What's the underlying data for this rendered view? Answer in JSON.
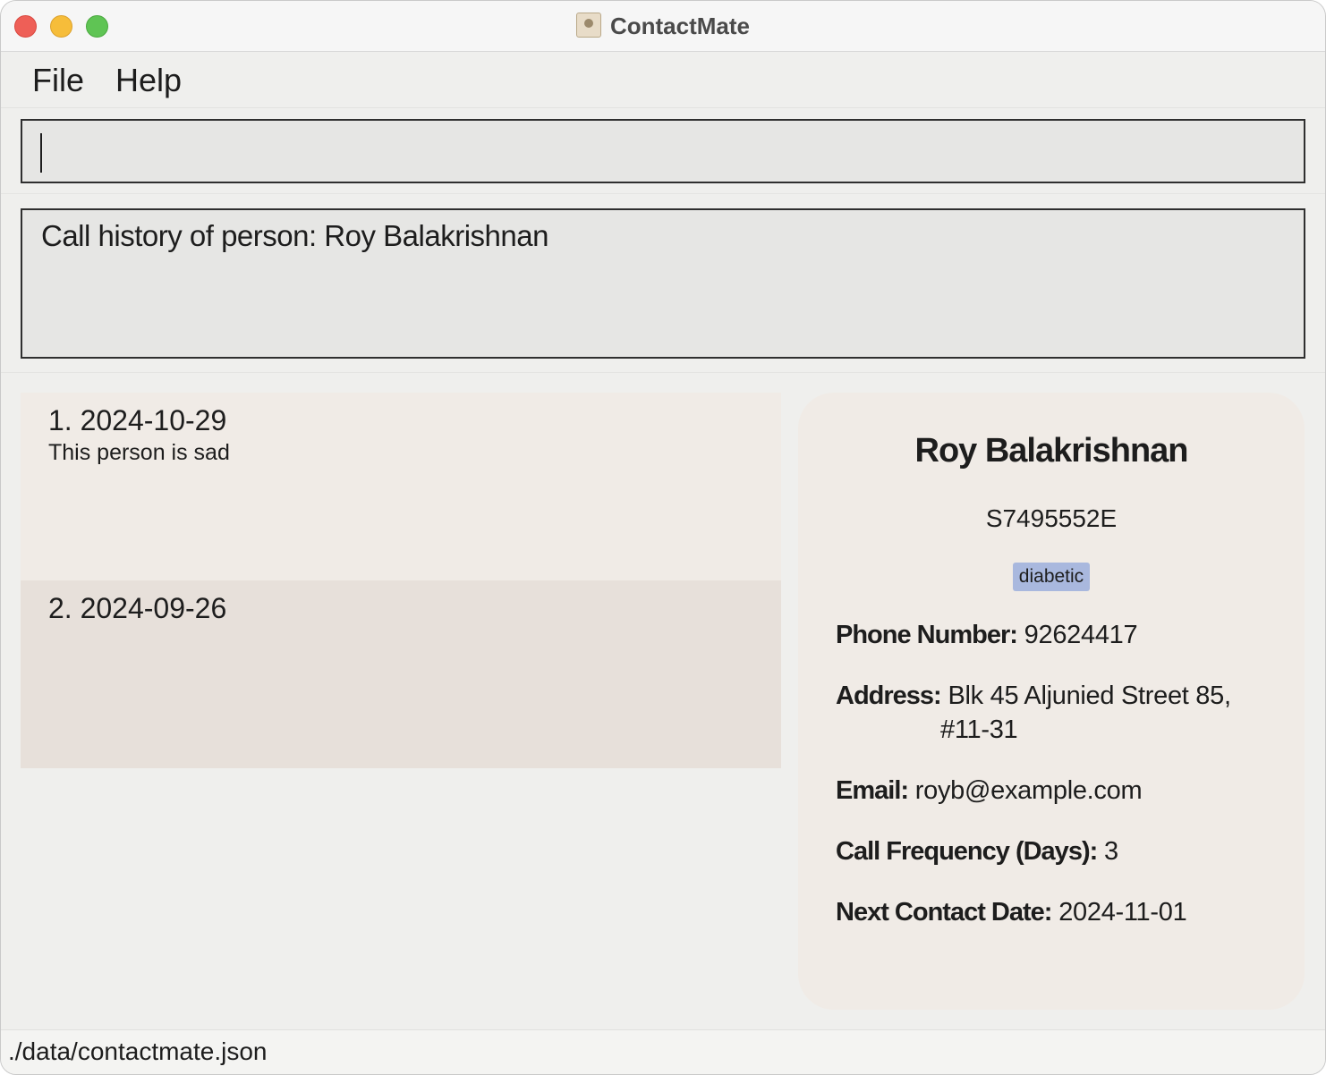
{
  "window": {
    "title": "ContactMate",
    "app_icon": "address-book-icon"
  },
  "menu": {
    "items": [
      "File",
      "Help"
    ]
  },
  "command_box": {
    "value": ""
  },
  "result_display": {
    "text": "Call history of person: Roy Balakrishnan"
  },
  "call_history": [
    {
      "date": "1. 2024-10-29",
      "note": "This person is sad"
    },
    {
      "date": "2. 2024-09-26",
      "note": ""
    }
  ],
  "person_card": {
    "name": "Roy Balakrishnan",
    "nric": "S7495552E",
    "tag": "diabetic",
    "phone_label": "Phone Number:",
    "phone": "92624417",
    "address_label": "Address:",
    "address_line1": "Blk 45 Aljunied Street 85,",
    "address_line2": "#11-31",
    "email_label": "Email:",
    "email": "royb@example.com",
    "freq_label": "Call Frequency (Days):",
    "freq": "3",
    "next_label": "Next Contact Date:",
    "next": "2024-11-01"
  },
  "status_bar": {
    "path": "./data/contactmate.json"
  },
  "colors": {
    "tag_bg": "#a9b8de",
    "card_bg": "#f0ebe6",
    "history_odd": "#f0ebe6",
    "history_even": "#e7e0da"
  }
}
